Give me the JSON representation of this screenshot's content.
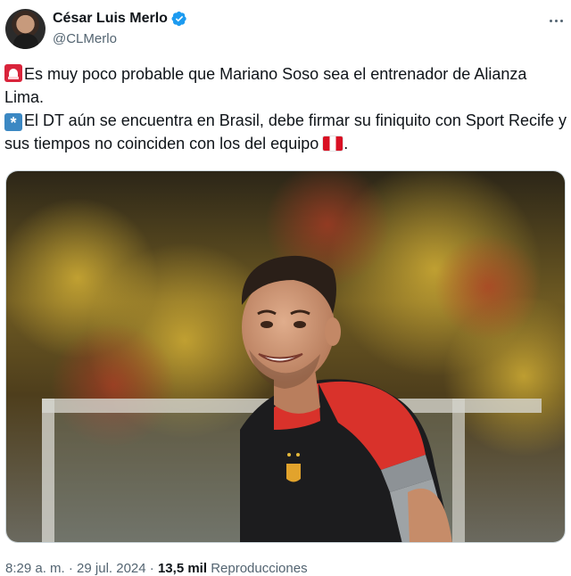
{
  "author": {
    "name": "César Luis Merlo",
    "handle": "@CLMerlo",
    "verified": true,
    "avatar_icon": "avatar-photo"
  },
  "tweet": {
    "line1": "Es muy poco probable que Mariano Soso sea el entrenador de Alianza Lima.",
    "line2": "El DT aún se encuentra en Brasil, debe firmar su finiquito con Sport Recife y sus tiempos no coinciden con los del equipo",
    "line2_end": ".",
    "emoji_1": "rotating-light-icon",
    "emoji_2": "asterisk-icon",
    "emoji_3": "flag-peru-icon"
  },
  "media": {
    "description_icon": "photo-of-coach-smiling"
  },
  "meta": {
    "time": "8:29 a. m.",
    "separator": "·",
    "date": "29 jul. 2024",
    "views_count": "13,5 mil",
    "views_label": "Reproducciones"
  },
  "colors": {
    "text_primary": "#0f1419",
    "text_secondary": "#536471",
    "verified_blue": "#1d9bf0",
    "border": "#cfd9de"
  }
}
